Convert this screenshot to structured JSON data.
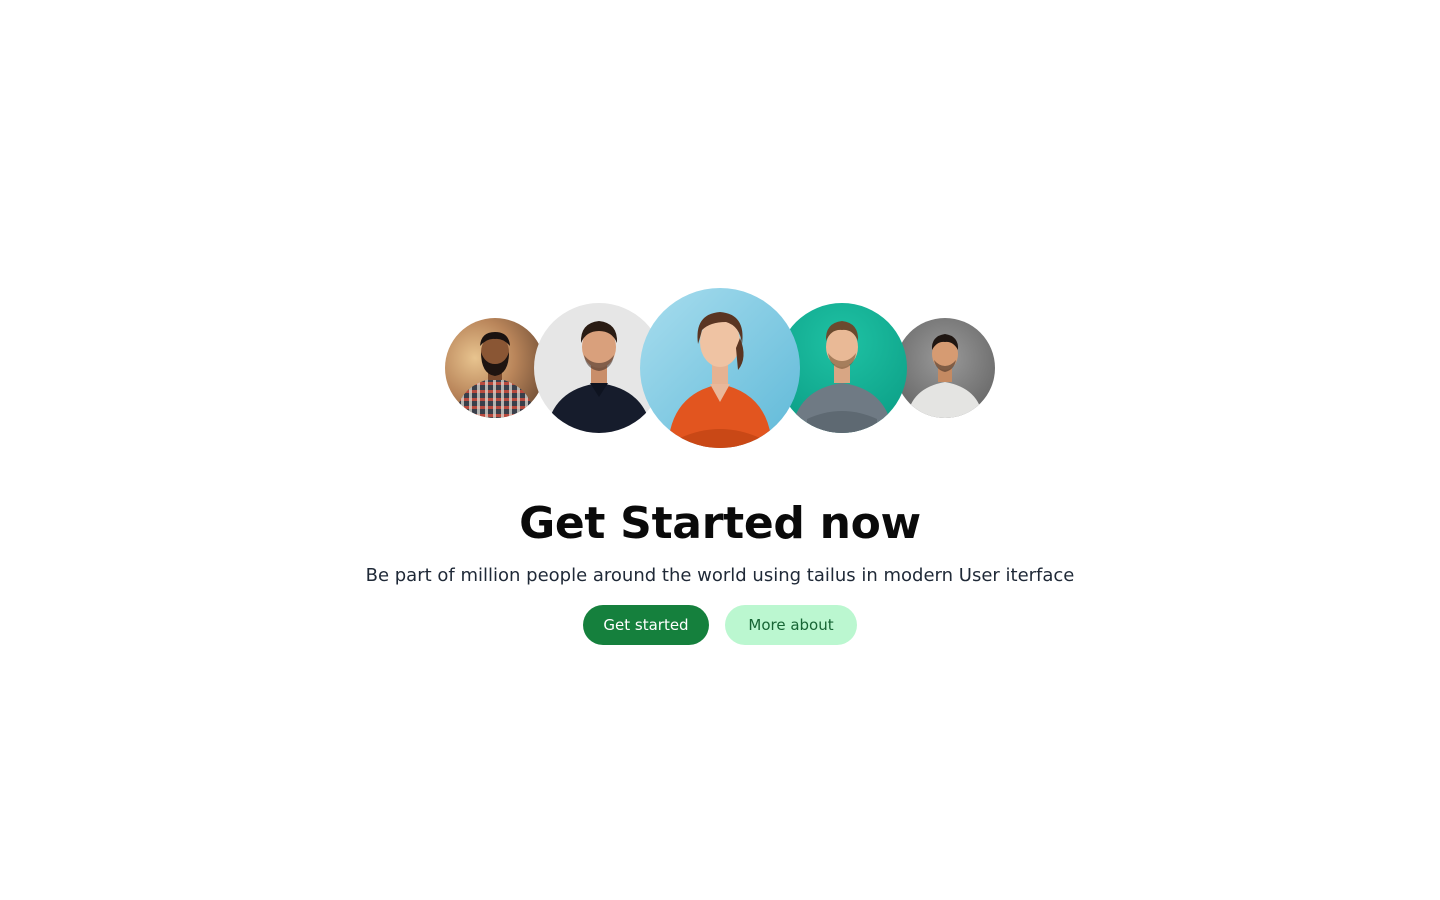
{
  "hero": {
    "title": "Get Started now",
    "subtitle": "Be part of million people around the world using tailus in modern User iterface",
    "primary_button": "Get started",
    "secondary_button": "More about"
  },
  "avatars": [
    {
      "name": "avatar-bearded-man-plaid-shirt"
    },
    {
      "name": "avatar-man-dark-shirt"
    },
    {
      "name": "avatar-woman-orange-shirt"
    },
    {
      "name": "avatar-man-grey-sweater"
    },
    {
      "name": "avatar-man-white-tshirt"
    }
  ],
  "colors": {
    "primary_button_bg": "#15803d",
    "primary_button_text": "#ffffff",
    "secondary_button_bg": "#bbf7d0",
    "secondary_button_text": "#166534",
    "title": "#0a0a0a",
    "subtitle": "#1f2937"
  }
}
